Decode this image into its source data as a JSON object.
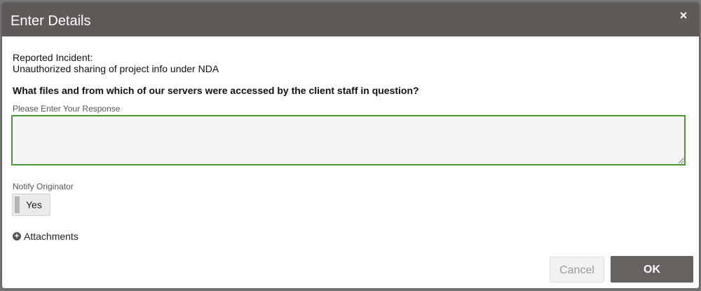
{
  "dialog": {
    "title": "Enter Details",
    "close_glyph": "×"
  },
  "incident": {
    "label": "Reported Incident:",
    "value": "Unauthorized sharing of project info under NDA"
  },
  "question": "What files and from which of our servers were accessed by the client staff in question?",
  "response": {
    "label": "Please Enter Your Response",
    "value": ""
  },
  "notify": {
    "label": "Notify Originator",
    "toggle_text": "Yes"
  },
  "attachments": {
    "icon_glyph": "+",
    "label": "Attachments"
  },
  "buttons": {
    "cancel": "Cancel",
    "ok": "OK"
  },
  "colors": {
    "header": "#5f5a57",
    "input_border": "#4a9a2f",
    "ok_button": "#676260"
  },
  "icons": {
    "close": "close-icon",
    "attachments": "plus-circle-icon"
  }
}
